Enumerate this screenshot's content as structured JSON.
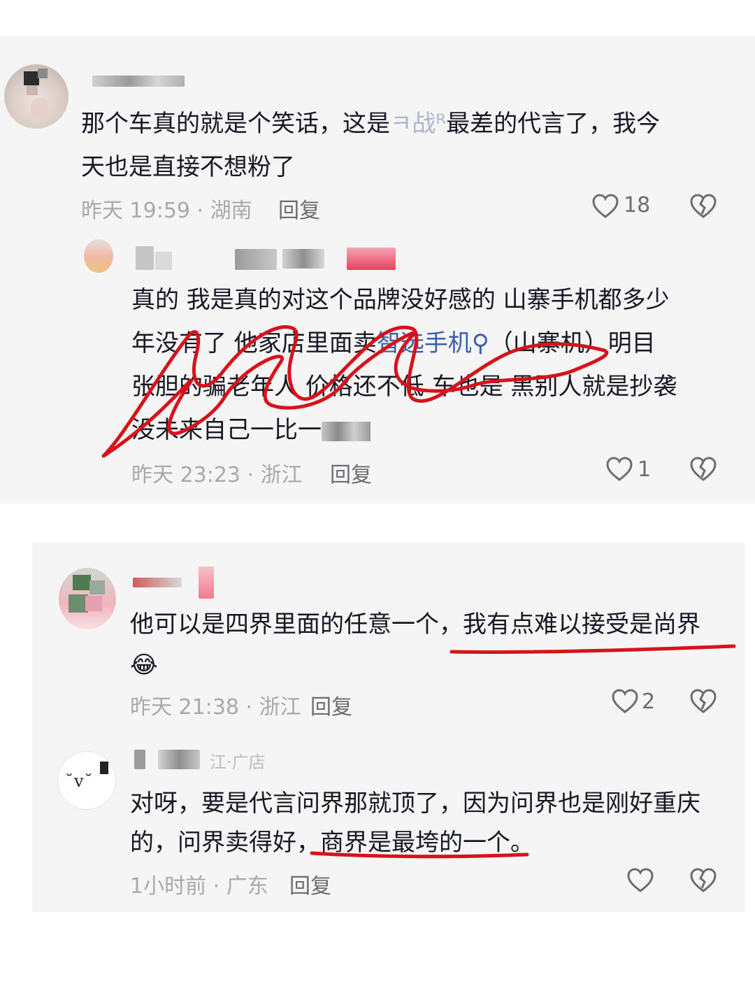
{
  "comments": [
    {
      "text_line1_prefix": "那个车真的就是个笑话，这是",
      "text_line1_name": "ㅋ战ᴿ",
      "text_line1_suffix": "最差的代言了，我今",
      "text_line2": "天也是直接不想粉了",
      "meta": "昨天 19:59 · 湖南",
      "reply_label": "回复",
      "likes": "18"
    },
    {
      "line1": "真的 我是真的对这个品牌没好感的 山寨手机都多少",
      "line2_prefix": "年没有了 他家店里面卖",
      "line2_link": "智选手机",
      "line2_suffix": "（山寨机）明目",
      "line3": "张胆的骗老年人 价格还不低 车也是 黑别人就是抄袭",
      "line4": "没未来自己一比一",
      "meta": "昨天 23:23 · 浙江",
      "reply_label": "回复",
      "likes": "1"
    },
    {
      "line1_prefix": "他可以是四界里面的任意一个，",
      "line1_highlight": "我有点难以接受是尚界",
      "emoji": "😂",
      "meta": "昨天 21:38 · 浙江",
      "reply_label": "回复",
      "likes": "2",
      "username_fragment": "江·广店"
    },
    {
      "line1": "对呀，要是代言问界那就顶了，因为问界也是刚好重庆",
      "line2_prefix": "的，问界卖得好，",
      "line2_highlight": "商界是最垮的一个。",
      "meta": "1小时前 · 广东",
      "reply_label": "回复",
      "likes": "",
      "avatar_text": "˘v˘"
    }
  ],
  "icons": {
    "like": "heart-outline-icon",
    "dislike": "broken-heart-icon"
  },
  "colors": {
    "annotation_red": "#d8121a",
    "link_blue": "#3a5ea8",
    "meta_gray": "#a8a9ad"
  }
}
